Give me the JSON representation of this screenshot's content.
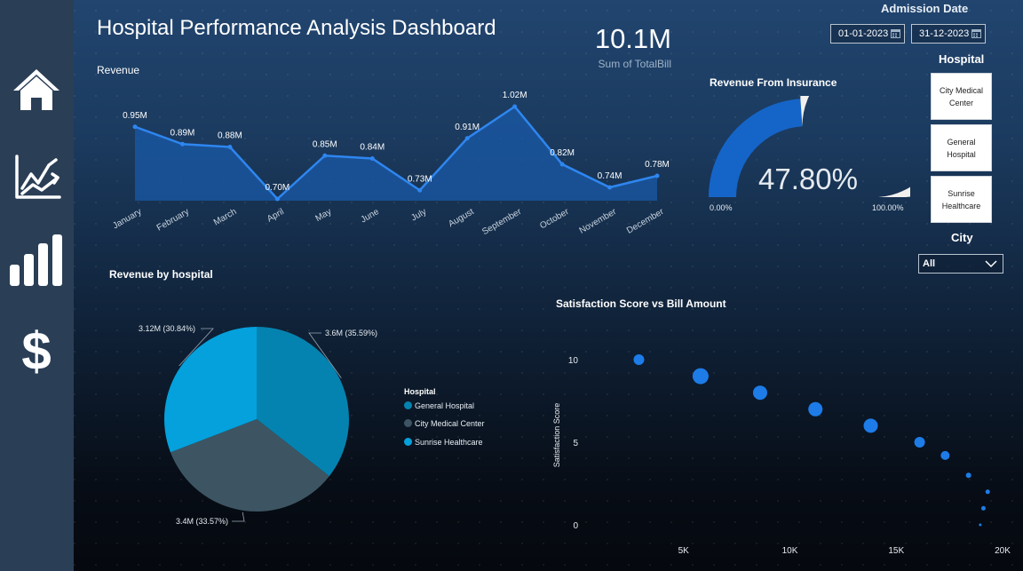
{
  "dashboard": {
    "title": "Hospital Performance Analysis Dashboard",
    "kpi": {
      "value": "10.1M",
      "label": "Sum of TotalBill"
    }
  },
  "sidebar": {
    "items": [
      {
        "icon": "home-icon"
      },
      {
        "icon": "line-chart-icon"
      },
      {
        "icon": "bar-chart-icon"
      },
      {
        "icon": "dollar-icon"
      }
    ]
  },
  "filters": {
    "admission_title": "Admission Date",
    "start_date": "01-01-2023",
    "end_date": "31-12-2023",
    "hospital_title": "Hospital",
    "hospitals": [
      "City Medical Center",
      "General Hospital",
      "Sunrise Healthcare"
    ],
    "city_title": "City",
    "city_value": "All"
  },
  "colors": {
    "line": "#2e86f0",
    "area": "#1a5aa8",
    "gauge_fill": "#1565c8",
    "gauge_track": "#f1f0ef",
    "general_hospital": "#0583b0",
    "city_medical": "#3d5562",
    "sunrise": "#04a1dc",
    "scatter_point": "#1d7ce8"
  },
  "chart_data": [
    {
      "type": "area",
      "title": "Revenue",
      "categories": [
        "January",
        "February",
        "March",
        "April",
        "May",
        "June",
        "July",
        "August",
        "September",
        "October",
        "November",
        "December"
      ],
      "values": [
        0.95,
        0.89,
        0.88,
        0.7,
        0.85,
        0.84,
        0.73,
        0.91,
        1.02,
        0.82,
        0.74,
        0.78
      ],
      "data_labels": [
        "0.95M",
        "0.89M",
        "0.88M",
        "0.70M",
        "0.85M",
        "0.84M",
        "0.73M",
        "0.91M",
        "1.02M",
        "0.82M",
        "0.74M",
        "0.78M"
      ],
      "ylim": [
        0.7,
        1.02
      ]
    },
    {
      "type": "gauge",
      "title": "Revenue From Insurance",
      "value": 47.8,
      "value_label": "47.80%",
      "min_label": "0.00%",
      "max_label": "100.00%"
    },
    {
      "type": "pie",
      "title": "Revenue by hospital",
      "legend_title": "Hospital",
      "series": [
        {
          "name": "General Hospital",
          "value": 3.6,
          "percent": 35.59,
          "label": "3.6M (35.59%)"
        },
        {
          "name": "City Medical Center",
          "value": 3.4,
          "percent": 33.57,
          "label": "3.4M (33.57%)"
        },
        {
          "name": "Sunrise Healthcare",
          "value": 3.12,
          "percent": 30.84,
          "label": "3.12M (30.84%)"
        }
      ]
    },
    {
      "type": "scatter",
      "title": "Satisfaction Score vs Bill Amount",
      "ylabel": "Satisfaction Score",
      "xticks": [
        "5K",
        "10K",
        "15K",
        "20K"
      ],
      "xtick_values": [
        5000,
        10000,
        15000,
        20000
      ],
      "yticks": [
        "10",
        "5",
        "0"
      ],
      "ytick_values": [
        10,
        5,
        0
      ],
      "xlim": [
        0,
        20000
      ],
      "ylim": [
        0,
        10
      ],
      "points": [
        {
          "x": 2900,
          "y": 10.0,
          "size": 6
        },
        {
          "x": 5800,
          "y": 9.0,
          "size": 9
        },
        {
          "x": 8600,
          "y": 8.0,
          "size": 8
        },
        {
          "x": 11200,
          "y": 7.0,
          "size": 8
        },
        {
          "x": 13800,
          "y": 6.0,
          "size": 8
        },
        {
          "x": 16100,
          "y": 5.0,
          "size": 6
        },
        {
          "x": 17300,
          "y": 4.2,
          "size": 5
        },
        {
          "x": 18400,
          "y": 3.0,
          "size": 3
        },
        {
          "x": 19300,
          "y": 2.0,
          "size": 2.5
        },
        {
          "x": 19100,
          "y": 1.0,
          "size": 2.5
        },
        {
          "x": 18950,
          "y": 0.0,
          "size": 1.5
        }
      ]
    }
  ]
}
